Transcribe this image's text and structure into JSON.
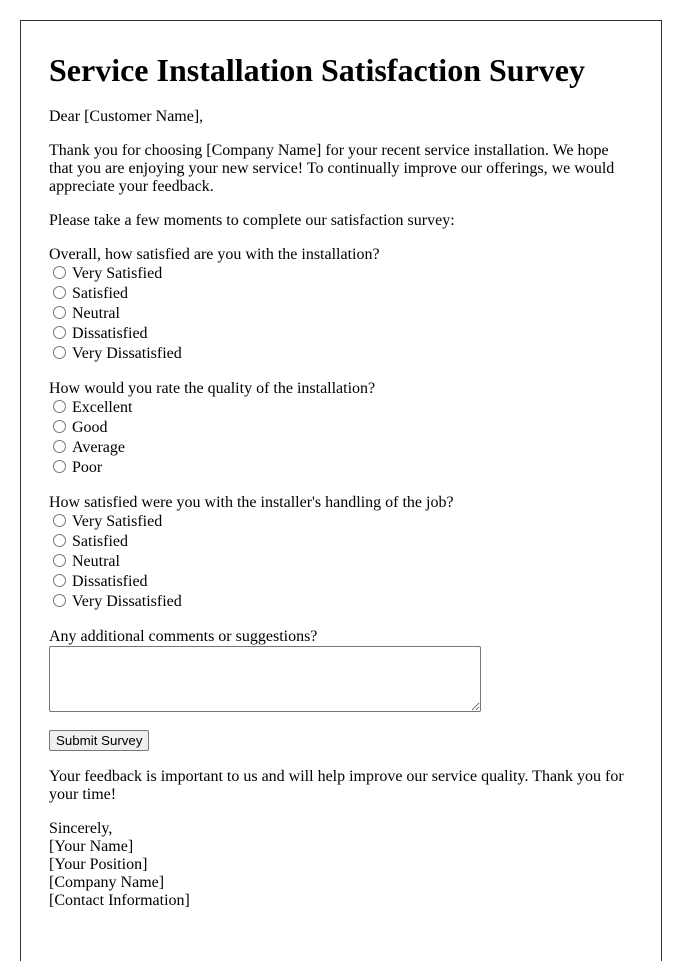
{
  "title": "Service Installation Satisfaction Survey",
  "greeting": "Dear [Customer Name],",
  "intro": "Thank you for choosing [Company Name] for your recent service installation. We hope that you are enjoying your new service! To continually improve our offerings, we would appreciate your feedback.",
  "prompt": "Please take a few moments to complete our satisfaction survey:",
  "questions": [
    {
      "label": "Overall, how satisfied are you with the installation?",
      "options": [
        "Very Satisfied",
        "Satisfied",
        "Neutral",
        "Dissatisfied",
        "Very Dissatisfied"
      ]
    },
    {
      "label": "How would you rate the quality of the installation?",
      "options": [
        "Excellent",
        "Good",
        "Average",
        "Poor"
      ]
    },
    {
      "label": "How satisfied were you with the installer's handling of the job?",
      "options": [
        "Very Satisfied",
        "Satisfied",
        "Neutral",
        "Dissatisfied",
        "Very Dissatisfied"
      ]
    }
  ],
  "comments": {
    "label": "Any additional comments or suggestions?",
    "value": "",
    "placeholder": ""
  },
  "submit_label": "Submit Survey",
  "closing": "Your feedback is important to us and will help improve our service quality. Thank you for your time!",
  "signature": {
    "salutation": "Sincerely,",
    "name": "[Your Name]",
    "position": "[Your Position]",
    "company": "[Company Name]",
    "contact": "[Contact Information]"
  }
}
